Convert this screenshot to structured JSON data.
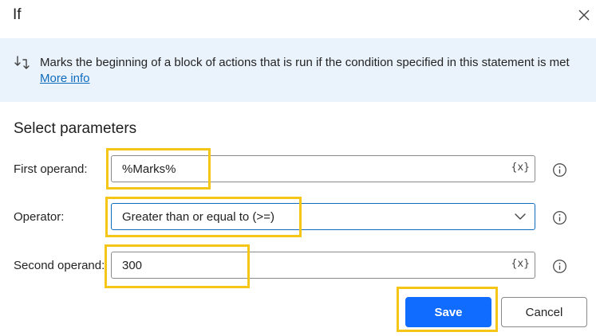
{
  "dialog": {
    "title": "If"
  },
  "info": {
    "text": "Marks the beginning of a block of actions that is run if the condition specified in this statement is met",
    "link": "More info"
  },
  "params": {
    "section_title": "Select parameters",
    "first_operand": {
      "label": "First operand:",
      "value": "%Marks%",
      "var_button": "{x}"
    },
    "operator": {
      "label": "Operator:",
      "value": "Greater than or equal to (>=)"
    },
    "second_operand": {
      "label": "Second operand:",
      "value": "300",
      "var_button": "{x}"
    }
  },
  "footer": {
    "save_label": "Save",
    "cancel_label": "Cancel"
  },
  "colors": {
    "accent": "#0f6cff",
    "banner_bg": "#eaf2fb",
    "link": "#0f6cbd",
    "highlight": "#f5c518"
  },
  "icons": {
    "close": "close-icon",
    "info": "arrow-branch-icon",
    "chevron": "chevron-down-icon",
    "help": "info-circle-icon"
  }
}
